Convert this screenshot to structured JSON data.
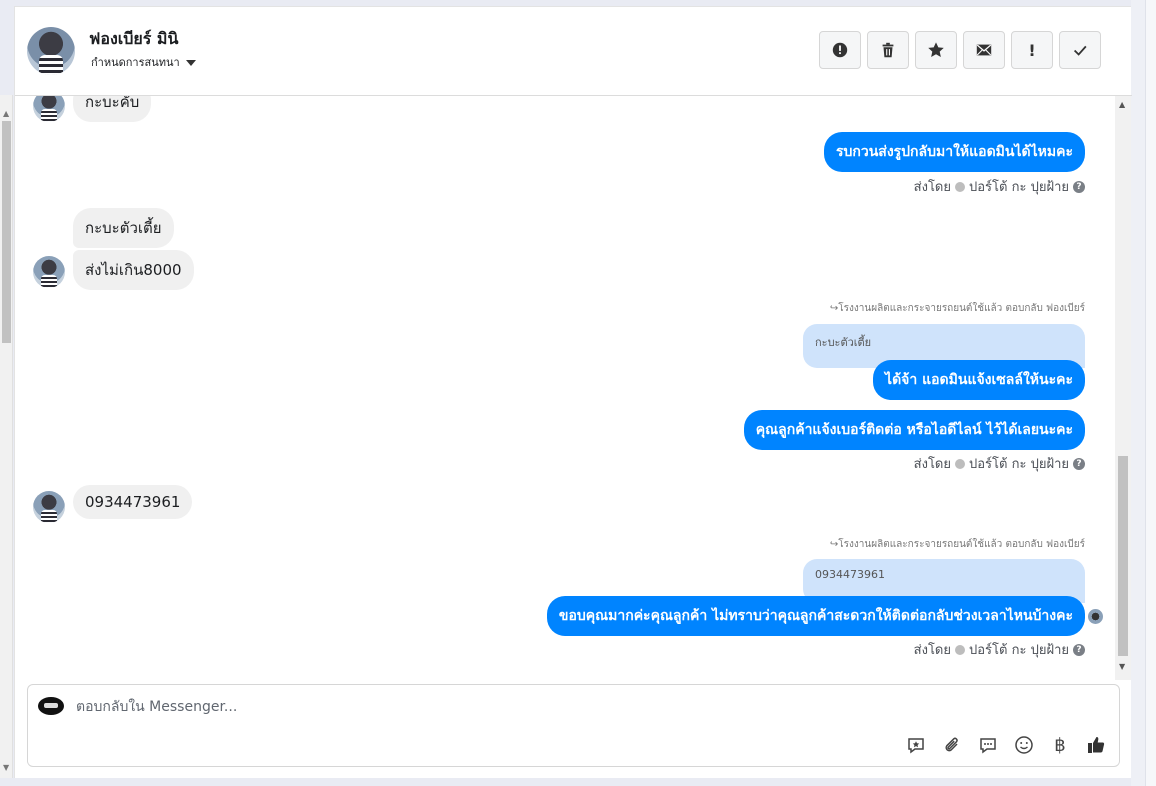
{
  "header": {
    "name": "ฟองเบียร์ มินิ",
    "subtitle": "กำหนดการสนทนา",
    "actions": [
      {
        "icon": "spam-alert-icon"
      },
      {
        "icon": "trash-icon"
      },
      {
        "icon": "star-icon"
      },
      {
        "icon": "envelope-icon"
      },
      {
        "icon": "exclamation-icon",
        "label": "!"
      },
      {
        "icon": "check-icon"
      }
    ]
  },
  "messages": {
    "m1_in": "กะบะคับ",
    "m2_out": "รบกวนส่งรูปกลับมาให้แอดมินได้ไหมคะ",
    "m2_meta_prefix": "ส่งโดย",
    "m2_meta_name": "ปอร์โต้ กะ ปุยฝ้าย",
    "m3_in": "กะบะตัวเตี้ย",
    "m4_in": "ส่งไม่เกิน8000",
    "m5_reply_note": "โรงงานผลิตและกระจายรถยนต์ใช้แล้ว ตอบกลับ ฟองเบียร์",
    "m5_quote": "กะบะตัวเตี้ย",
    "m5_out": "ได้จ้า แอดมินแจ้งเซลล์ให้นะคะ",
    "m6_out": "คุณลูกค้าแจ้งเบอร์ติดต่อ หรือไอดีไลน์ ไว้ได้เลยนะคะ",
    "m6_meta_prefix": "ส่งโดย",
    "m6_meta_name": "ปอร์โต้ กะ ปุยฝ้าย",
    "m7_in": "0934473961",
    "m8_reply_note": "โรงงานผลิตและกระจายรถยนต์ใช้แล้ว ตอบกลับ ฟองเบียร์",
    "m8_quote": "0934473961",
    "m8_out": "ขอบคุณมากค่ะคุณลูกค้า ไม่ทราบว่าคุณลูกค้าสะดวกให้ติดต่อกลับช่วงเวลาไหนบ้างคะ",
    "m8_meta_prefix": "ส่งโดย",
    "m8_meta_name": "ปอร์โต้ กะ ปุยฝ้าย"
  },
  "composer": {
    "placeholder": "ตอบกลับใน Messenger...",
    "tools": [
      "saved-reply-icon",
      "attachment-icon",
      "chat-bubble-icon",
      "emoji-icon",
      "baht-icon",
      "like-icon"
    ],
    "baht_symbol": "฿"
  },
  "colors": {
    "outgoing_bubble": "#0084ff",
    "incoming_bubble": "#f0f0f0",
    "quote_bubble": "#cfe3fb"
  }
}
